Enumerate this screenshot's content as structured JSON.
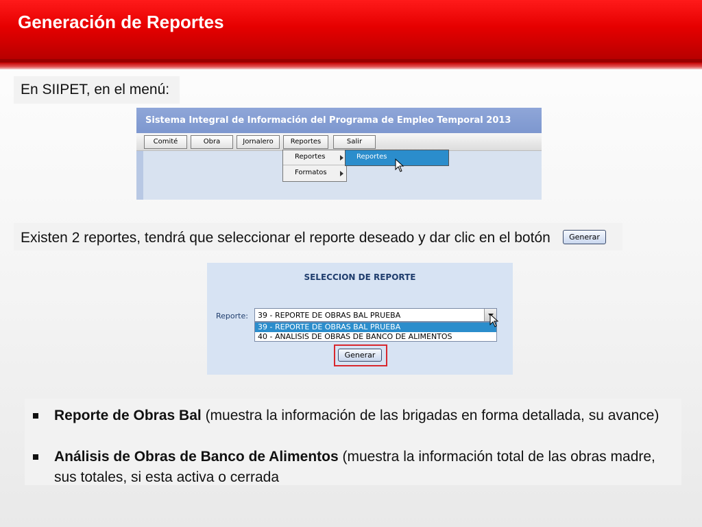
{
  "slide": {
    "title": "Generación de Reportes",
    "intro": "En SIIPET, en el menú:",
    "instruction": "Existen 2 reportes, tendrá que seleccionar el reporte deseado y dar clic en el botón",
    "generar_inline_label": "Generar"
  },
  "menu_screenshot": {
    "app_title": "Sistema Integral de Información del Programa de Empleo Temporal 2013",
    "menu_items": [
      "Comité",
      "Obra",
      "Jornalero",
      "Reportes",
      "Salir"
    ],
    "submenu_items": [
      "Reportes",
      "Formatos"
    ],
    "flyout_item": "Reportes"
  },
  "selection_screenshot": {
    "title": "SELECCION DE REPORTE",
    "label": "Reporte:",
    "selected_value": "39 - REPORTE DE OBRAS BAL PRUEBA",
    "options": [
      "39 - REPORTE DE OBRAS BAL PRUEBA",
      "40 - ANALISIS DE OBRAS DE BANCO DE ALIMENTOS"
    ],
    "button_label": "Generar"
  },
  "bullets": [
    {
      "bold": "Reporte de Obras Bal",
      "text": " (muestra la información de las brigadas en forma detallada, su avance)"
    },
    {
      "bold": "Análisis de Obras de Banco de Alimentos",
      "text": " (muestra la información total de las obras madre,",
      "text2": "sus totales, si esta activa o cerrada"
    }
  ]
}
